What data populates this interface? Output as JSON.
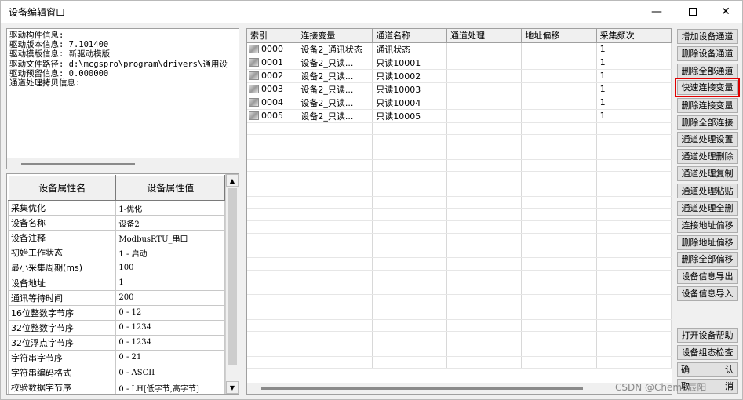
{
  "window": {
    "title": "设备编辑窗口",
    "minimize": "—",
    "close": "✕"
  },
  "driver_info": [
    "驱动构件信息:",
    "驱动版本信息: 7.101400",
    "驱动模版信息: 新驱动模版",
    "驱动文件路径: d:\\mcgspro\\program\\drivers\\通用设",
    "驱动预留信息: 0.000000",
    "通道处理拷贝信息:"
  ],
  "properties": {
    "headers": [
      "设备属性名",
      "设备属性值"
    ],
    "rows": [
      [
        "采集优化",
        "1-优化"
      ],
      [
        "设备名称",
        "设备2"
      ],
      [
        "设备注释",
        "ModbusRTU_串口"
      ],
      [
        "初始工作状态",
        "1 - 启动"
      ],
      [
        "最小采集周期(ms)",
        "100"
      ],
      [
        "设备地址",
        "1"
      ],
      [
        "通讯等待时间",
        "200"
      ],
      [
        "16位整数字节序",
        "0 - 12"
      ],
      [
        "32位整数字节序",
        "0 - 1234"
      ],
      [
        "32位浮点字节序",
        "0 - 1234"
      ],
      [
        "字符串字节序",
        "0 - 21"
      ],
      [
        "字符串编码格式",
        "0 - ASCII"
      ],
      [
        "校验数据字节序",
        "0 - LH[低字节,高字节]"
      ]
    ]
  },
  "channels": {
    "headers": [
      "索引",
      "连接变量",
      "通道名称",
      "通道处理",
      "地址偏移",
      "采集频次"
    ],
    "rows": [
      [
        "0000",
        "设备2_通讯状态",
        "通讯状态",
        "",
        "",
        "1"
      ],
      [
        "0001",
        "设备2_只读...",
        "只读10001",
        "",
        "",
        "1"
      ],
      [
        "0002",
        "设备2_只读...",
        "只读10002",
        "",
        "",
        "1"
      ],
      [
        "0003",
        "设备2_只读...",
        "只读10003",
        "",
        "",
        "1"
      ],
      [
        "0004",
        "设备2_只读...",
        "只读10004",
        "",
        "",
        "1"
      ],
      [
        "0005",
        "设备2_只读...",
        "只读10005",
        "",
        "",
        "1"
      ]
    ],
    "empty_rows": 20
  },
  "buttons": {
    "add_channel": "增加设备通道",
    "delete_channel": "删除设备通道",
    "delete_all_channels": "删除全部通道",
    "quick_connect": "快速连接变量",
    "delete_connect": "删除连接变量",
    "delete_all_connect": "删除全部连接",
    "proc_setup": "通道处理设置",
    "proc_delete": "通道处理删除",
    "proc_copy": "通道处理复制",
    "proc_paste": "通道处理粘贴",
    "proc_delete_all": "通道处理全删",
    "addr_offset": "连接地址偏移",
    "delete_offset": "删除地址偏移",
    "delete_all_offset": "删除全部偏移",
    "export_info": "设备信息导出",
    "import_info": "设备信息导入",
    "open_help": "打开设备帮助",
    "config_check": "设备组态检查",
    "ok_left": "确",
    "ok_right": "认",
    "cancel_left": "取",
    "cancel_right": "消"
  },
  "highlight_color": "#e00000",
  "watermark": "CSDN @Chemo辰阳"
}
